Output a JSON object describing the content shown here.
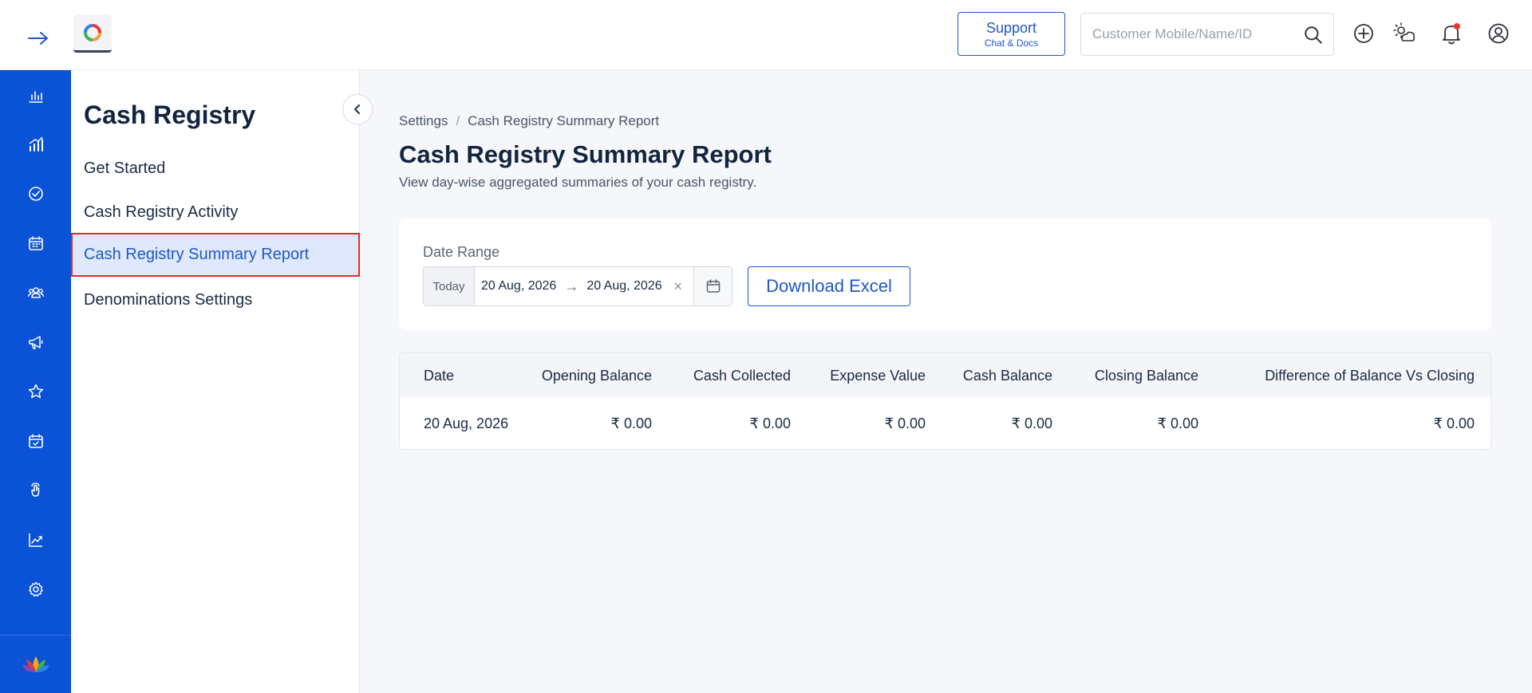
{
  "header": {
    "support_title": "Support",
    "support_sub": "Chat & Docs",
    "search_placeholder": "Customer Mobile/Name/ID",
    "icons": [
      "arrow-right-icon",
      "logo-icon",
      "search-icon",
      "plus-circle-icon",
      "weather-icon",
      "bell-icon",
      "user-circle-icon"
    ],
    "notification_dot_color": "#e53935"
  },
  "rail": {
    "items": [
      "bar-chart-icon",
      "growth-chart-icon",
      "check-circle-icon",
      "calendar-icon",
      "users-icon",
      "megaphone-icon",
      "star-icon",
      "calendar-check-icon",
      "hand-pointer-icon",
      "trend-line-icon",
      "gear-icon"
    ],
    "bottom_logo": "lotus-logo-icon"
  },
  "sidebar": {
    "title": "Cash Registry",
    "items": [
      {
        "label": "Get Started"
      },
      {
        "label": "Cash Registry Activity"
      },
      {
        "label": "Cash Registry Summary Report"
      },
      {
        "label": "Denominations Settings"
      }
    ],
    "active_index": 2
  },
  "breadcrumb": {
    "root": "Settings",
    "separator": "/",
    "current": "Cash Registry Summary Report"
  },
  "page": {
    "title": "Cash Registry Summary Report",
    "subtitle": "View day-wise aggregated summaries of your cash registry."
  },
  "filter": {
    "label": "Date Range",
    "preset": "Today",
    "start": "20 Aug, 2026",
    "arrow": "→",
    "end": "20 Aug, 2026",
    "clear": "×",
    "download_label": "Download Excel"
  },
  "table": {
    "headers": {
      "date": "Date",
      "opening": "Opening Balance",
      "collected": "Cash Collected",
      "expense": "Expense Value",
      "balance": "Cash Balance",
      "closing": "Closing Balance",
      "difference": "Difference of Balance Vs Closing"
    },
    "rows": [
      {
        "date": "20 Aug, 2026",
        "opening": "₹ 0.00",
        "collected": "₹ 0.00",
        "expense": "₹ 0.00",
        "balance": "₹ 0.00",
        "closing": "₹ 0.00",
        "difference": "₹ 0.00"
      }
    ]
  },
  "colors": {
    "brand_blue": "#0a53d6",
    "accent_blue": "#1f58c7",
    "active_bg": "#dfe9fb",
    "highlight_red": "#e02b2b"
  }
}
